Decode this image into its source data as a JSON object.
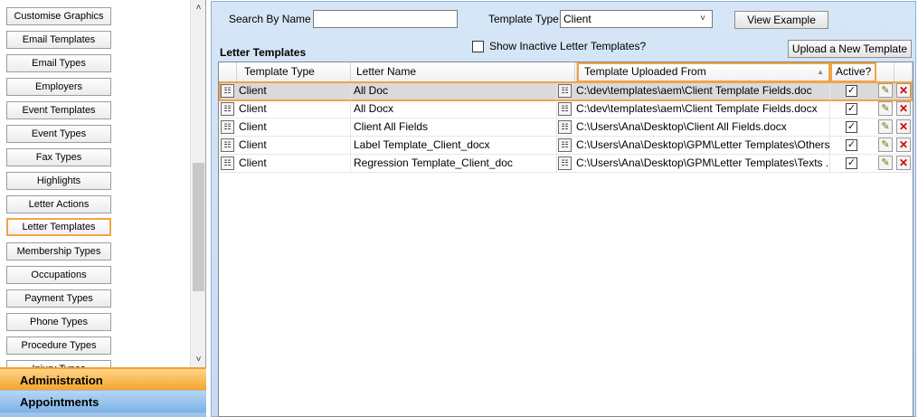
{
  "sidebar": {
    "items": [
      {
        "label": "Customise Graphics"
      },
      {
        "label": "Email Templates"
      },
      {
        "label": "Email Types"
      },
      {
        "label": "Employers"
      },
      {
        "label": "Event Templates"
      },
      {
        "label": "Event Types"
      },
      {
        "label": "Fax Types"
      },
      {
        "label": "Highlights"
      },
      {
        "label": "Letter Actions"
      },
      {
        "label": "Letter Templates",
        "selected": true
      },
      {
        "label": "Membership Types"
      },
      {
        "label": "Occupations"
      },
      {
        "label": "Payment Types"
      },
      {
        "label": "Phone Types"
      },
      {
        "label": "Procedure Types"
      },
      {
        "label": "Injury Types"
      }
    ],
    "scroll_up_icon": "chevron-up-icon",
    "scroll_down_icon": "chevron-down-icon"
  },
  "sections": {
    "administration": "Administration",
    "appointments": "Appointments"
  },
  "search": {
    "label": "Search By Name",
    "value": "",
    "template_type_label": "Template Type",
    "template_type_value": "Client",
    "view_example_label": "View Example"
  },
  "letter_templates": {
    "title": "Letter Templates",
    "show_inactive_label": "Show Inactive Letter Templates?",
    "show_inactive_checked": false,
    "upload_label": "Upload a New Template"
  },
  "grid": {
    "columns": {
      "template_type": "Template Type",
      "letter_name": "Letter Name",
      "uploaded_from": "Template Uploaded From",
      "active": "Active?"
    },
    "rows": [
      {
        "type": "Client",
        "name": "All Doc",
        "path": "C:\\dev\\templates\\aem\\Client Template Fields.doc",
        "active": true
      },
      {
        "type": "Client",
        "name": "All Docx",
        "path": "C:\\dev\\templates\\aem\\Client Template Fields.docx",
        "active": true
      },
      {
        "type": "Client",
        "name": "Client All Fields",
        "path": "C:\\Users\\Ana\\Desktop\\Client All Fields.docx",
        "active": true
      },
      {
        "type": "Client",
        "name": "Label Template_Client_docx",
        "path": "C:\\Users\\Ana\\Desktop\\GPM\\Letter Templates\\Others...",
        "active": true
      },
      {
        "type": "Client",
        "name": "Regression Template_Client_doc",
        "path": "C:\\Users\\Ana\\Desktop\\GPM\\Letter Templates\\Texts ...",
        "active": true
      }
    ]
  },
  "colors": {
    "highlight_orange": "#f2a346",
    "admin_bar": "#f6a42c",
    "appointments_bar": "#7db2e6",
    "panel_blue": "#d6e6f7",
    "delete_red": "#d00000"
  }
}
